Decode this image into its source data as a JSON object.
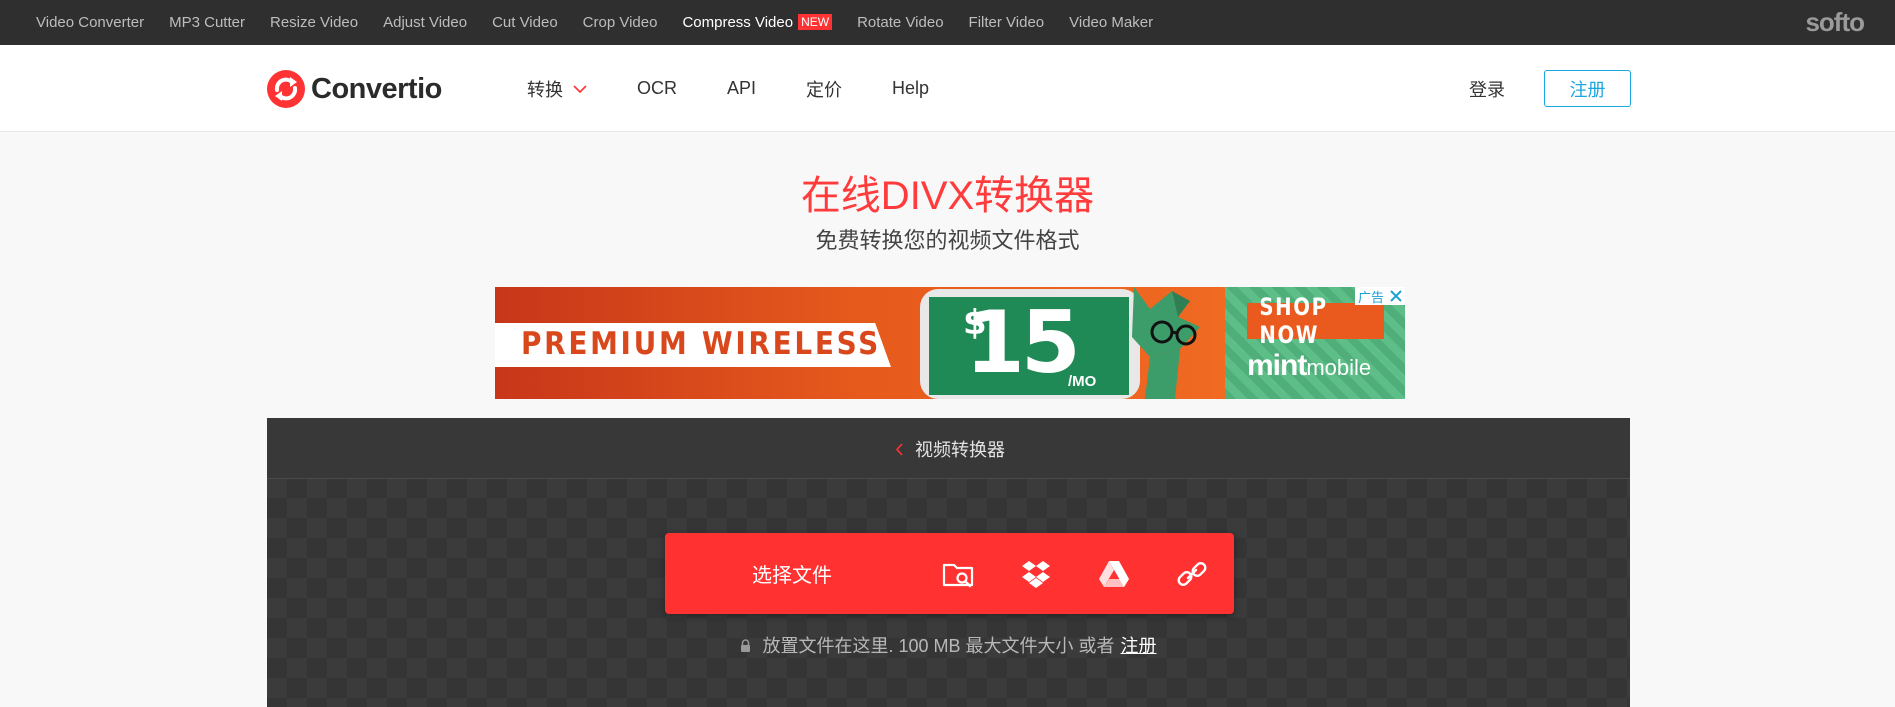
{
  "topbar": {
    "tools": [
      {
        "label": "Video Converter",
        "active": false
      },
      {
        "label": "MP3 Cutter",
        "active": false
      },
      {
        "label": "Resize Video",
        "active": false
      },
      {
        "label": "Adjust Video",
        "active": false
      },
      {
        "label": "Cut Video",
        "active": false
      },
      {
        "label": "Crop Video",
        "active": false
      },
      {
        "label": "Compress Video",
        "active": true,
        "badge": "NEW"
      },
      {
        "label": "Rotate Video",
        "active": false
      },
      {
        "label": "Filter Video",
        "active": false
      },
      {
        "label": "Video Maker",
        "active": false
      }
    ],
    "brand": "softo"
  },
  "header": {
    "logo_text": "Convertio",
    "nav": [
      "转换",
      "OCR",
      "API",
      "定价",
      "Help"
    ],
    "login": "登录",
    "register": "注册"
  },
  "hero": {
    "title": "在线DIVX转换器",
    "subtitle": "免费转换您的视频文件格式"
  },
  "ad": {
    "headline": "PREMIUM WIRELESS",
    "price_symbol": "$",
    "price": "15",
    "price_unit": "/MO",
    "cta": "SHOP NOW",
    "brand_main": "mint",
    "brand_suffix": "mobile",
    "ad_label": "广告"
  },
  "converter": {
    "breadcrumb": "视频转换器",
    "select_label": "选择文件",
    "sources": [
      "folder-search-icon",
      "dropbox-icon",
      "google-drive-icon",
      "link-icon"
    ],
    "drop_note": "放置文件在这里. 100 MB 最大文件大小 或者",
    "drop_note_link": "注册"
  },
  "colors": {
    "accent": "#ff3131",
    "link_blue": "#1ca6e0",
    "topbar_bg": "#2f2f2f",
    "panel_bg": "#353535"
  }
}
